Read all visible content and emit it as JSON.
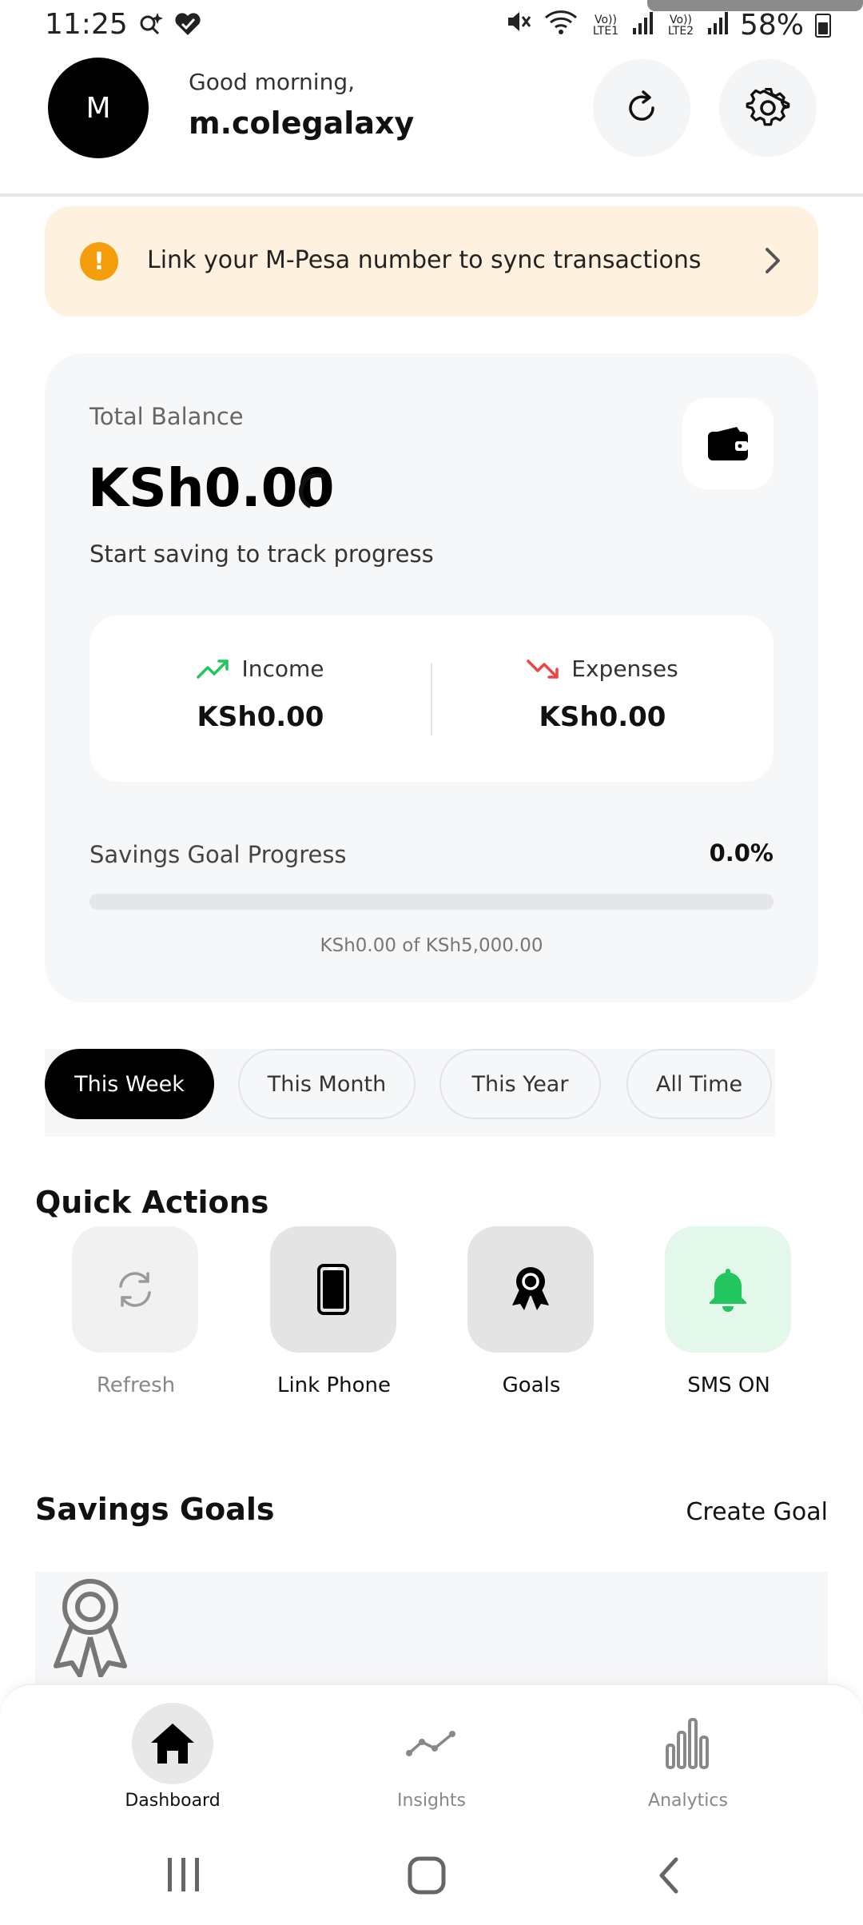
{
  "status_bar": {
    "time": "11:25",
    "network1": "Vo)) LTE1",
    "network2": "Vo)) LTE2",
    "battery": "58%"
  },
  "header": {
    "avatar_initial": "M",
    "greeting": "Good morning,",
    "username": "m.colegalaxy"
  },
  "banner": {
    "text": "Link your M-Pesa number to sync transactions",
    "warn_symbol": "!"
  },
  "balance": {
    "label": "Total Balance",
    "amount": "KSh0.00",
    "subtitle": "Start saving to track progress",
    "income_label": "Income",
    "income_value": "KSh0.00",
    "expenses_label": "Expenses",
    "expenses_value": "KSh0.00",
    "goal_label": "Savings Goal Progress",
    "goal_percent": "0.0%",
    "goal_progress_fraction": 0.0,
    "goal_of": "KSh0.00 of KSh5,000.00"
  },
  "period_tabs": [
    {
      "label": "This Week",
      "active": true
    },
    {
      "label": "This Month",
      "active": false
    },
    {
      "label": "This Year",
      "active": false
    },
    {
      "label": "All Time",
      "active": false
    }
  ],
  "quick_actions": {
    "title": "Quick Actions",
    "items": [
      {
        "label": "Refresh",
        "icon": "refresh-icon"
      },
      {
        "label": "Link Phone",
        "icon": "phone-icon"
      },
      {
        "label": "Goals",
        "icon": "award-icon"
      },
      {
        "label": "SMS ON",
        "icon": "bell-icon"
      }
    ]
  },
  "savings_goals": {
    "title": "Savings Goals",
    "create_label": "Create Goal"
  },
  "bottom_nav": [
    {
      "label": "Dashboard",
      "icon": "home-icon",
      "active": true
    },
    {
      "label": "Insights",
      "icon": "insights-icon",
      "active": false
    },
    {
      "label": "Analytics",
      "icon": "analytics-icon",
      "active": false
    }
  ],
  "colors": {
    "accent": "#000000",
    "banner_bg": "#fff1e0",
    "warning": "#f59e0b",
    "income_green": "#22c55e",
    "expense_red": "#ef4444",
    "sms_bg": "#e3f7ea"
  }
}
